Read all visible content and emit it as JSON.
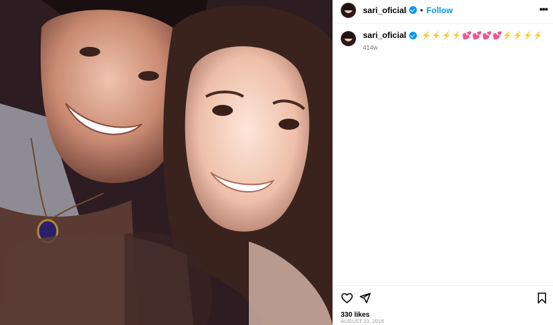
{
  "post": {
    "username": "sari_oficial",
    "follow_label": "Follow",
    "separator": "•",
    "more_label": "•••",
    "caption": {
      "username": "sari_oficial",
      "text": "⚡⚡⚡⚡💕💕💕💕⚡⚡⚡⚡",
      "time": "414w"
    },
    "likes": "330 likes",
    "date": "AUGUST 23, 2015"
  },
  "icons": {
    "verified": "verified-badge-icon",
    "like": "heart-icon",
    "share": "paper-plane-icon",
    "save": "bookmark-icon",
    "more": "more-options-icon"
  },
  "colors": {
    "accent": "#0095f6",
    "muted": "#737373"
  }
}
